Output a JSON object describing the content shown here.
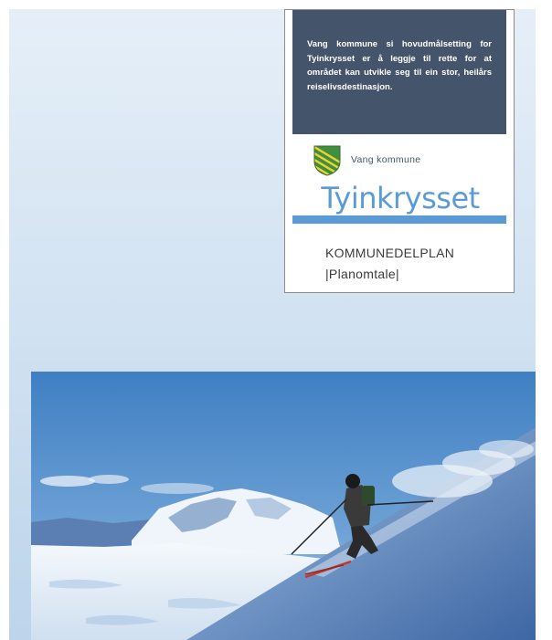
{
  "cover": {
    "summary": "Vang kommune si hovudmålsetting for Tyinkrysset er å leggje til rette for at området kan utvikle seg til ein stor, heilårs reiselivsdestinasjon.",
    "municipality": "Vang kommune",
    "title": "Tyinkrysset",
    "plan_type": "KOMMUNEDELPLAN",
    "plan_subtitle": "|Planomtale|",
    "icons": [
      "coat-of-arms-shield"
    ],
    "image": "skier-descending-snowy-slope",
    "colors": {
      "summary_box": "#44546a",
      "title": "#5b9bd5",
      "accent_bar": "#5b9bd5",
      "page_background": "#d3e3f2"
    }
  }
}
